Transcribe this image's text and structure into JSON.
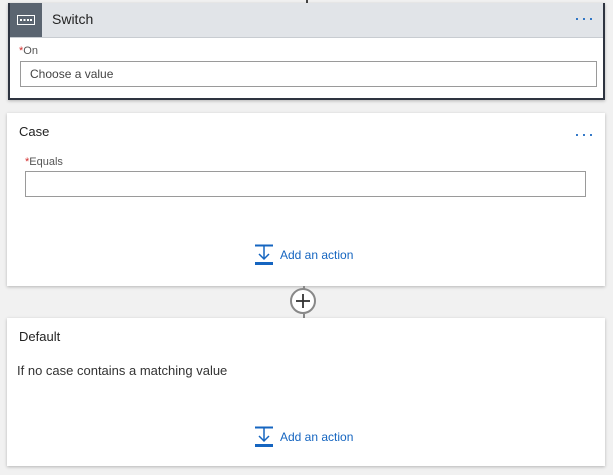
{
  "switch": {
    "title": "Switch",
    "more": "···",
    "on_label": "On",
    "required_mark": "*",
    "on_placeholder": "Choose a value"
  },
  "case": {
    "title": "Case",
    "more": "···",
    "equals_label": "Equals",
    "required_mark": "*",
    "equals_value": "",
    "add_action": "Add an action"
  },
  "default": {
    "title": "Default",
    "description": "If no case contains a matching value",
    "add_action": "Add an action"
  },
  "colors": {
    "accent": "#1565c0",
    "required": "#d32f2f"
  }
}
